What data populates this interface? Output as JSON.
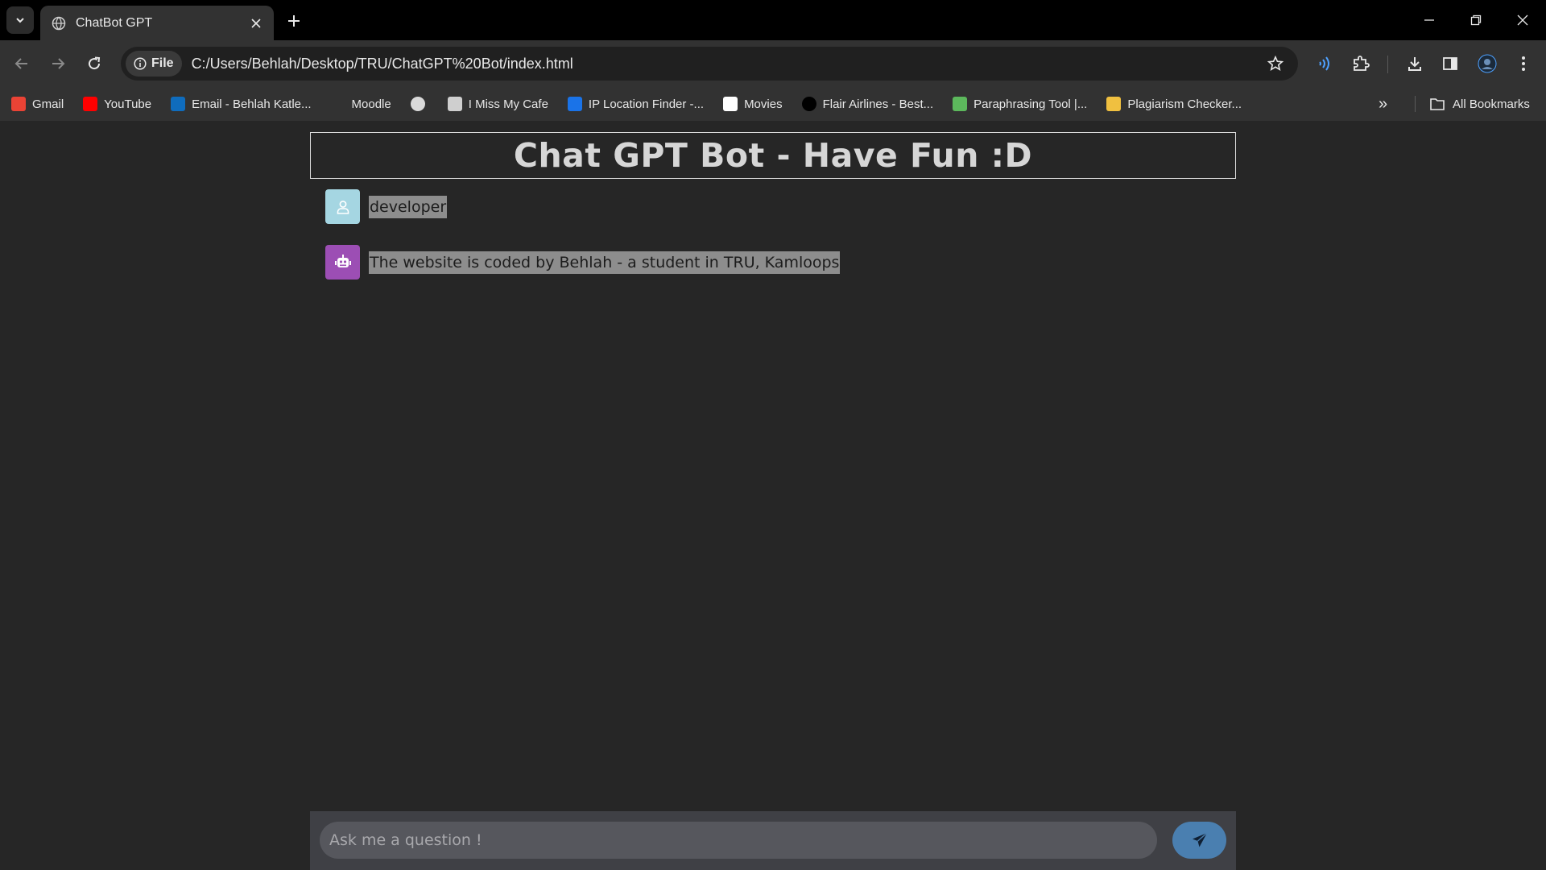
{
  "browser": {
    "tab_title": "ChatBot GPT",
    "site_chip": "File",
    "url": "C:/Users/Behlah/Desktop/TRU/ChatGPT%20Bot/index.html",
    "bookmarks": [
      {
        "label": "Gmail",
        "icon": "gmail-icon",
        "color": "#ea4335"
      },
      {
        "label": "YouTube",
        "icon": "youtube-icon",
        "color": "#ff0000"
      },
      {
        "label": "Email - Behlah Katle...",
        "icon": "outlook-icon",
        "color": "#0f6cbd"
      },
      {
        "label": "Moodle",
        "icon": "moodle-icon",
        "color": "#1f3a5f"
      },
      {
        "label": "",
        "icon": "skull-icon",
        "color": "#d9d9d9"
      },
      {
        "label": "I Miss My Cafe",
        "icon": "cafe-icon",
        "color": "#cfcfcf"
      },
      {
        "label": "IP Location Finder -...",
        "icon": "location-icon",
        "color": "#1a73e8"
      },
      {
        "label": "Movies",
        "icon": "movies-icon",
        "color": "#ffffff"
      },
      {
        "label": "Flair Airlines - Best...",
        "icon": "flair-icon",
        "color": "#000000"
      },
      {
        "label": "Paraphrasing Tool |...",
        "icon": "paraphrase-icon",
        "color": "#5cb85c"
      },
      {
        "label": "Plagiarism Checker...",
        "icon": "magnifier-icon",
        "color": "#f0c040"
      }
    ],
    "more_label": "»",
    "all_bookmarks": "All Bookmarks"
  },
  "page": {
    "title": "Chat GPT Bot - Have Fun :D",
    "messages": [
      {
        "role": "user",
        "text": "developer"
      },
      {
        "role": "bot",
        "text": "The website is coded by Behlah - a student in TRU, Kamloops"
      }
    ],
    "input_placeholder": "Ask me a question !",
    "colors": {
      "user_avatar": "#a5d6e2",
      "bot_avatar": "#9c4eb4",
      "send_button": "#4a7fb0"
    }
  }
}
